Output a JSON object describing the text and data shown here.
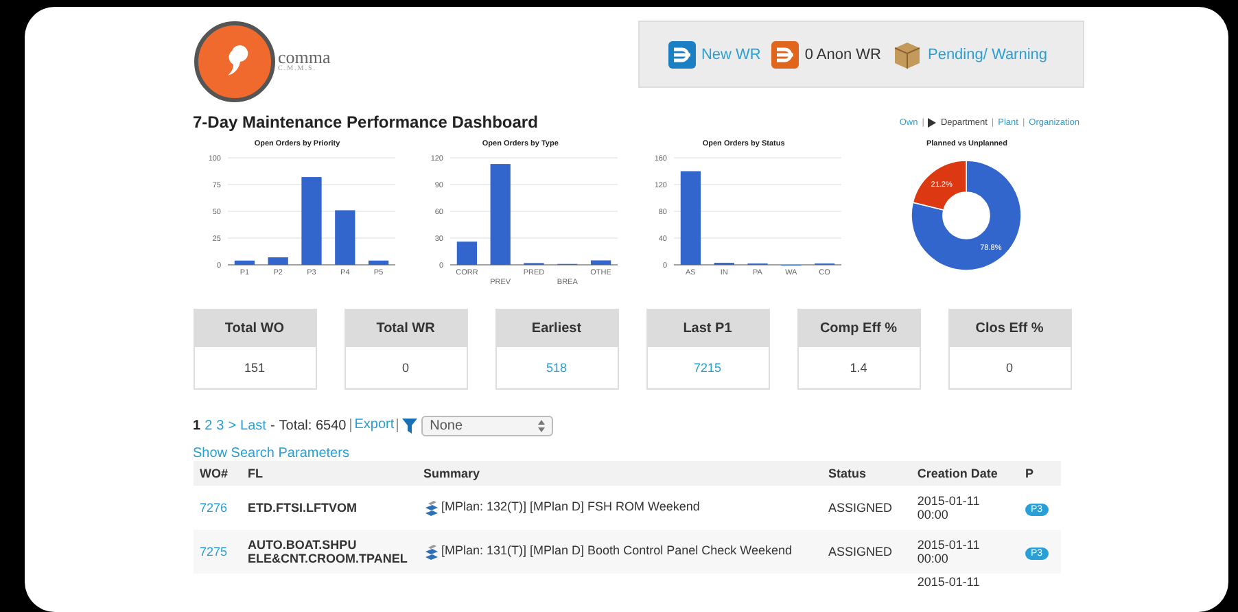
{
  "logo": {
    "name": "comma",
    "tagline": "C.M.M.S."
  },
  "quick_actions": [
    {
      "kind": "new",
      "label": "New WR",
      "link": true
    },
    {
      "kind": "anon",
      "label": "0 Anon WR",
      "link": false
    },
    {
      "kind": "pending",
      "label": "Pending/ Warning",
      "link": true
    }
  ],
  "title": "7-Day Maintenance Performance Dashboard",
  "view_separator": "|",
  "view_links": [
    {
      "label": "Own",
      "selected": false
    },
    {
      "label": "Department",
      "selected": true
    },
    {
      "label": "Plant",
      "selected": false
    },
    {
      "label": "Organization",
      "selected": false
    }
  ],
  "charts": [
    {
      "chart_data": {
        "type": "bar",
        "title": "Open Orders by Priority",
        "categories": [
          "P1",
          "P2",
          "P3",
          "P4",
          "P5"
        ],
        "series": [
          {
            "color": "#3366cc",
            "values": [
              4,
              7,
              82,
              51,
              4
            ]
          }
        ],
        "ylim": [
          0,
          100
        ],
        "yticks": [
          0,
          25,
          50,
          75,
          100
        ],
        "grid": true
      }
    },
    {
      "chart_data": {
        "type": "bar",
        "title": "Open Orders by Type",
        "categories": [
          "CORR",
          "PREV",
          "PRED",
          "BREA",
          "OTHE"
        ],
        "series": [
          {
            "color": "#3366cc",
            "values": [
              26,
              113,
              2,
              1,
              5
            ]
          }
        ],
        "ylim": [
          0,
          120
        ],
        "yticks": [
          0,
          30,
          60,
          90,
          120
        ],
        "grid": true
      }
    },
    {
      "chart_data": {
        "type": "bar",
        "title": "Open Orders by Status",
        "categories": [
          "AS",
          "IN",
          "PA",
          "WA",
          "CO"
        ],
        "series": [
          {
            "color": "#3366cc",
            "values": [
              140,
              3,
              2,
              0,
              2
            ]
          }
        ],
        "ylim": [
          0,
          160
        ],
        "yticks": [
          0,
          40,
          80,
          120,
          160
        ],
        "grid": true
      }
    },
    {
      "chart_data": {
        "type": "donut",
        "title": "Planned vs Unplanned",
        "values": [
          78.8,
          21.2
        ],
        "colors": [
          "#3366cc",
          "#dc3912"
        ],
        "value_labels": [
          "78.8%",
          "21.2%"
        ]
      }
    }
  ],
  "stats": [
    {
      "label": "Total WO",
      "value": "151",
      "link": false
    },
    {
      "label": "Total WR",
      "value": "0",
      "link": false
    },
    {
      "label": "Earliest",
      "value": "518",
      "link": true
    },
    {
      "label": "Last P1",
      "value": "7215",
      "link": true
    },
    {
      "label": "Comp Eff %",
      "value": "1.4",
      "link": false
    },
    {
      "label": "Clos Eff %",
      "value": "0",
      "link": false
    }
  ],
  "pagination": {
    "pages": [
      {
        "label": "1",
        "selected": true
      },
      {
        "label": "2",
        "selected": false
      },
      {
        "label": "3",
        "selected": false
      }
    ],
    "next": ">",
    "last": "Last",
    "separator": "-",
    "total": "Total: 6540",
    "export": "Export",
    "filter_value": "None"
  },
  "search_link": "Show Search Parameters",
  "table": {
    "columns": [
      "WO#",
      "FL",
      "Summary",
      "Status",
      "Creation Date",
      "P"
    ],
    "rows": [
      {
        "wo": "7276",
        "fl": "ETD.FTSI.LFTVOM",
        "summary": "[MPlan: 132(T)] [MPlan D] FSH ROM Weekend",
        "status": "ASSIGNED",
        "date": "2015-01-11 00:00",
        "priority": "P3"
      },
      {
        "wo": "7275",
        "fl": "AUTO.BOAT.SHPU ELE&CNT.CROOM.TPANEL",
        "summary": "[MPlan: 131(T)] [MPlan D] Booth Control Panel Check Weekend",
        "status": "ASSIGNED",
        "date": "2015-01-11 00:00",
        "priority": "P3"
      },
      {
        "date": "2015-01-11"
      }
    ]
  }
}
